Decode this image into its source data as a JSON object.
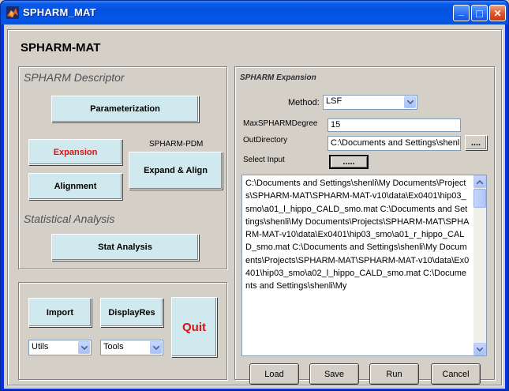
{
  "window": {
    "title": "SPHARM_MAT",
    "minimize_glyph": "_",
    "maximize_glyph": "□",
    "close_glyph": "✕"
  },
  "app": {
    "title": "SPHARM-MAT"
  },
  "descriptor_panel": {
    "title": "SPHARM Descriptor",
    "parameterization_label": "Parameterization",
    "expansion_label": "Expansion",
    "spharm_pdm_label": "SPHARM-PDM",
    "expand_align_label": "Expand & Align",
    "alignment_label": "Alignment",
    "statistical_title": "Statistical Analysis",
    "stat_analysis_label": "Stat Analysis"
  },
  "bottom_panel": {
    "import_label": "Import",
    "displayres_label": "DisplayRes",
    "quit_label": "Quit",
    "utils_selected": "Utils",
    "tools_selected": "Tools"
  },
  "expansion_panel": {
    "title": "SPHARM Expansion",
    "method_label": "Method:",
    "method_value": "LSF",
    "max_degree_label": "MaxSPHARMDegree",
    "max_degree_value": "15",
    "out_dir_label": "OutDirectory",
    "out_dir_value": "C:\\Documents and Settings\\shenli\\M",
    "browse_label": "....",
    "select_input_label": "Select Input",
    "select_input_button": ".....",
    "input_files_text": "C:\\Documents and Settings\\shenli\\My Documents\\Projects\\SPHARM-MAT\\SPHARM-MAT-v10\\data\\Ex0401\\hip03_smo\\a01_l_hippo_CALD_smo.mat C:\\Documents and Settings\\shenli\\My Documents\\Projects\\SPHARM-MAT\\SPHARM-MAT-v10\\data\\Ex0401\\hip03_smo\\a01_r_hippo_CALD_smo.mat C:\\Documents and Settings\\shenli\\My Documents\\Projects\\SPHARM-MAT\\SPHARM-MAT-v10\\data\\Ex0401\\hip03_smo\\a02_l_hippo_CALD_smo.mat C:\\Documents and Settings\\shenli\\My",
    "load_label": "Load",
    "save_label": "Save",
    "run_label": "Run",
    "cancel_label": "Cancel"
  },
  "colors": {
    "title_bar": "#0452e0",
    "button_face": "#cfe9ee",
    "accent_red": "#e01010",
    "window_bg": "#d4d0c8"
  }
}
